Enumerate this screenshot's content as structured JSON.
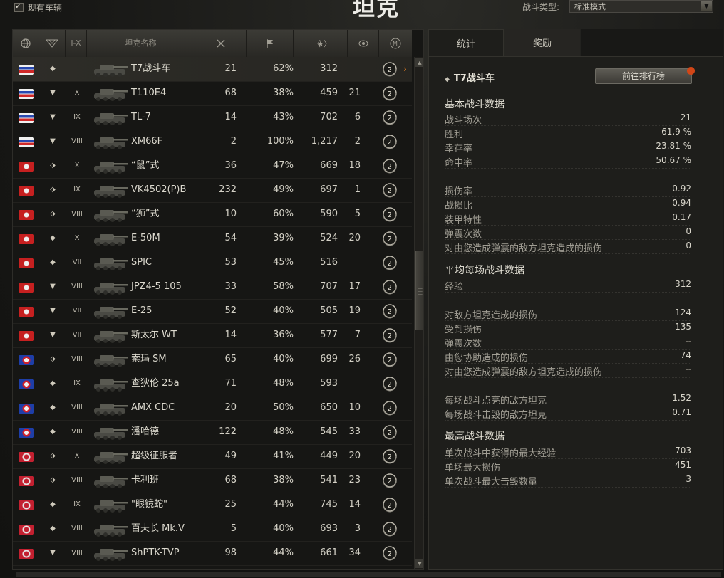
{
  "header": {
    "owned_label": "现有车辆",
    "page_title": "坦克",
    "battle_type_label": "战斗类型:",
    "battle_type_value": "标准模式"
  },
  "table": {
    "columns": {
      "tier": "I-X",
      "name": "坦克名称"
    },
    "column_icons": [
      "globe-icon",
      "vehicle-class-icon",
      "battles-icon",
      "win-flag-icon",
      "avg-xp-star-icon",
      "eye-icon",
      "mastery-badge-icon"
    ],
    "rows": [
      {
        "nation": "usa",
        "cls": "light",
        "tier": "II",
        "name": "T7战斗车",
        "battles": "21",
        "win": "62%",
        "xp": "312",
        "kills": "",
        "selected": true
      },
      {
        "nation": "usa",
        "cls": "heavy",
        "tier": "X",
        "name": "T110E4",
        "battles": "68",
        "win": "38%",
        "xp": "459",
        "kills": "21"
      },
      {
        "nation": "usa",
        "cls": "heavy",
        "tier": "IX",
        "name": "TL-7",
        "battles": "14",
        "win": "43%",
        "xp": "702",
        "kills": "6"
      },
      {
        "nation": "usa",
        "cls": "heavy",
        "tier": "VIII",
        "name": "XM66F",
        "battles": "2",
        "win": "100%",
        "xp": "1,217",
        "kills": "2"
      },
      {
        "nation": "ger",
        "cls": "hvy",
        "tier": "X",
        "name": "“鼠”式",
        "battles": "36",
        "win": "47%",
        "xp": "669",
        "kills": "18"
      },
      {
        "nation": "ger",
        "cls": "hvy",
        "tier": "IX",
        "name": "VK4502(P)B",
        "battles": "232",
        "win": "49%",
        "xp": "697",
        "kills": "1"
      },
      {
        "nation": "ger",
        "cls": "hvy",
        "tier": "VIII",
        "name": "“狮”式",
        "battles": "10",
        "win": "60%",
        "xp": "590",
        "kills": "5"
      },
      {
        "nation": "ger",
        "cls": "light",
        "tier": "X",
        "name": "E-50M",
        "battles": "54",
        "win": "39%",
        "xp": "524",
        "kills": "20"
      },
      {
        "nation": "ger",
        "cls": "light",
        "tier": "VII",
        "name": "SPIC",
        "battles": "53",
        "win": "45%",
        "xp": "516",
        "kills": ""
      },
      {
        "nation": "ger",
        "cls": "heavy",
        "tier": "VIII",
        "name": "JPZ4-5 105",
        "battles": "33",
        "win": "58%",
        "xp": "707",
        "kills": "17"
      },
      {
        "nation": "ger",
        "cls": "heavy",
        "tier": "VII",
        "name": "E-25",
        "battles": "52",
        "win": "40%",
        "xp": "505",
        "kills": "19"
      },
      {
        "nation": "ger",
        "cls": "heavy",
        "tier": "VII",
        "name": "斯太尔 WT",
        "battles": "14",
        "win": "36%",
        "xp": "577",
        "kills": "7"
      },
      {
        "nation": "fra",
        "cls": "hvy",
        "tier": "VIII",
        "name": "索玛 SM",
        "battles": "65",
        "win": "40%",
        "xp": "699",
        "kills": "26"
      },
      {
        "nation": "fra",
        "cls": "light",
        "tier": "IX",
        "name": "查狄伦 25a",
        "battles": "71",
        "win": "48%",
        "xp": "593",
        "kills": ""
      },
      {
        "nation": "fra",
        "cls": "light",
        "tier": "VIII",
        "name": "AMX CDC",
        "battles": "20",
        "win": "50%",
        "xp": "650",
        "kills": "10"
      },
      {
        "nation": "fra",
        "cls": "light",
        "tier": "VIII",
        "name": "潘哈德",
        "battles": "122",
        "win": "48%",
        "xp": "545",
        "kills": "33"
      },
      {
        "nation": "uk",
        "cls": "hvy",
        "tier": "X",
        "name": "超级征服者",
        "battles": "49",
        "win": "41%",
        "xp": "449",
        "kills": "20"
      },
      {
        "nation": "uk",
        "cls": "hvy",
        "tier": "VIII",
        "name": "卡利班",
        "battles": "68",
        "win": "38%",
        "xp": "541",
        "kills": "23"
      },
      {
        "nation": "uk",
        "cls": "light",
        "tier": "IX",
        "name": "\"眼镜蛇\"",
        "battles": "25",
        "win": "44%",
        "xp": "745",
        "kills": "14"
      },
      {
        "nation": "uk",
        "cls": "light",
        "tier": "VIII",
        "name": "百夫长 Mk.V",
        "battles": "5",
        "win": "40%",
        "xp": "693",
        "kills": "3"
      },
      {
        "nation": "uk",
        "cls": "heavy",
        "tier": "VIII",
        "name": "ShPTK-TVP",
        "battles": "98",
        "win": "44%",
        "xp": "661",
        "kills": "34"
      }
    ]
  },
  "tabs": [
    "统计",
    "奖励"
  ],
  "detail": {
    "vehicle_name": "T7战斗车",
    "rank_button": "前往排行榜",
    "badge": "!",
    "sections": [
      {
        "title": "基本战斗数据",
        "stats": [
          {
            "label": "战斗场次",
            "value": "21"
          },
          {
            "label": "胜利",
            "value": "61.9 %"
          },
          {
            "label": "幸存率",
            "value": "23.81 %"
          },
          {
            "label": "命中率",
            "value": "50.67 %"
          }
        ]
      },
      {
        "title": "",
        "stats": [
          {
            "label": "损伤率",
            "value": "0.92"
          },
          {
            "label": "战损比",
            "value": "0.94"
          },
          {
            "label": "装甲特性",
            "value": "0.17"
          },
          {
            "label": "弹震次数",
            "value": "0"
          },
          {
            "label": "对由您造成弹震的敌方坦克造成的损伤",
            "value": "0"
          }
        ]
      },
      {
        "title": "平均每场战斗数据",
        "stats": [
          {
            "label": "经验",
            "value": "312"
          }
        ]
      },
      {
        "title": "",
        "stats": [
          {
            "label": "对敌方坦克造成的损伤",
            "value": "124"
          },
          {
            "label": "受到损伤",
            "value": "135"
          },
          {
            "label": "弹震次数",
            "value": "--"
          },
          {
            "label": "由您协助造成的损伤",
            "value": "74"
          },
          {
            "label": "对由您造成弹震的敌方坦克造成的损伤",
            "value": "--"
          }
        ]
      },
      {
        "title": "",
        "stats": [
          {
            "label": "每场战斗点亮的敌方坦克",
            "value": "1.52"
          },
          {
            "label": "每场战斗击毁的敌方坦克",
            "value": "0.71"
          }
        ]
      },
      {
        "title": "最高战斗数据",
        "stats": [
          {
            "label": "单次战斗中获得的最大经验",
            "value": "703"
          },
          {
            "label": "单场最大损伤",
            "value": "451"
          },
          {
            "label": "单次战斗最大击毁数量",
            "value": "3"
          }
        ]
      }
    ]
  }
}
